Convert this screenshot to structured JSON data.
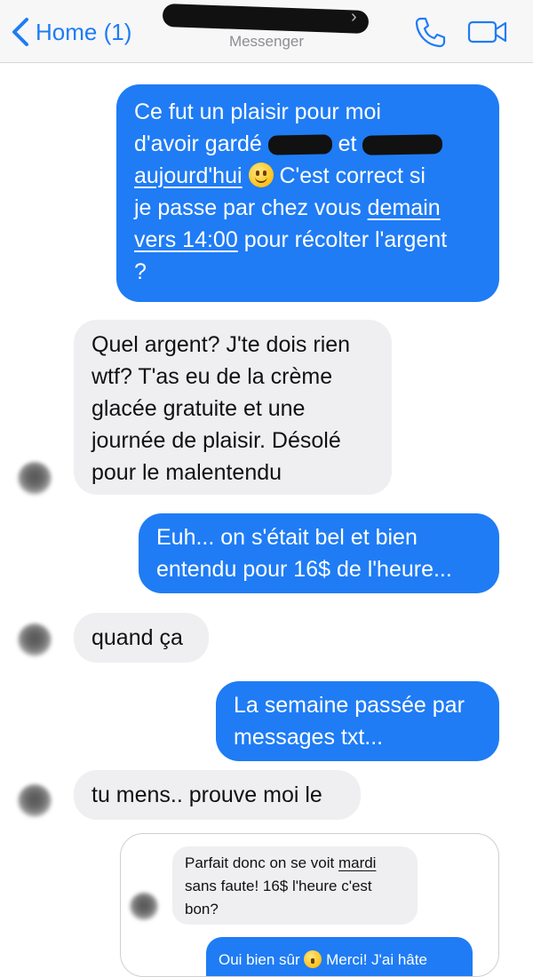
{
  "header": {
    "back_label": "Home (1)",
    "app_name": "Messenger"
  },
  "messages": [
    {
      "type": "outgoing",
      "parts": [
        "Ce fut un plaisir pour moi",
        "d'avoir gardé",
        "et",
        "aujourd'hui",
        "C'est correct si",
        "je passe par chez vous",
        "demain",
        "vers 14:00",
        "pour récolter l'argent",
        "?"
      ]
    },
    {
      "type": "incoming",
      "lines": [
        "Quel argent? J'te dois rien",
        "wtf? T'as eu de la crème",
        "glacée gratuite et une",
        "journée de plaisir. Désolé",
        "pour le malentendu"
      ]
    },
    {
      "type": "outgoing",
      "lines": [
        "Euh... on s'était bel et bien",
        "entendu pour 16$ de l'heure..."
      ]
    },
    {
      "type": "incoming",
      "lines": [
        "quand ça"
      ]
    },
    {
      "type": "outgoing",
      "lines": [
        "La semaine passée par",
        "messages txt..."
      ]
    },
    {
      "type": "incoming",
      "lines": [
        "tu mens.. prouve moi le"
      ]
    }
  ],
  "screenshot": {
    "incoming": [
      "Parfait donc on se voit",
      "mardi",
      "sans faute! 16$ l'heure c'est",
      "bon?"
    ],
    "outgoing_partial": [
      "Oui bien sûr",
      "Merci! J'ai hâte"
    ]
  },
  "colors": {
    "accent": "#1f7cf5",
    "incoming_bubble": "#efeff1",
    "header_bg": "#f7f7f8"
  },
  "icons": [
    "chevron-left-icon",
    "phone-icon",
    "video-camera-icon",
    "smiley-emoji-icon"
  ]
}
